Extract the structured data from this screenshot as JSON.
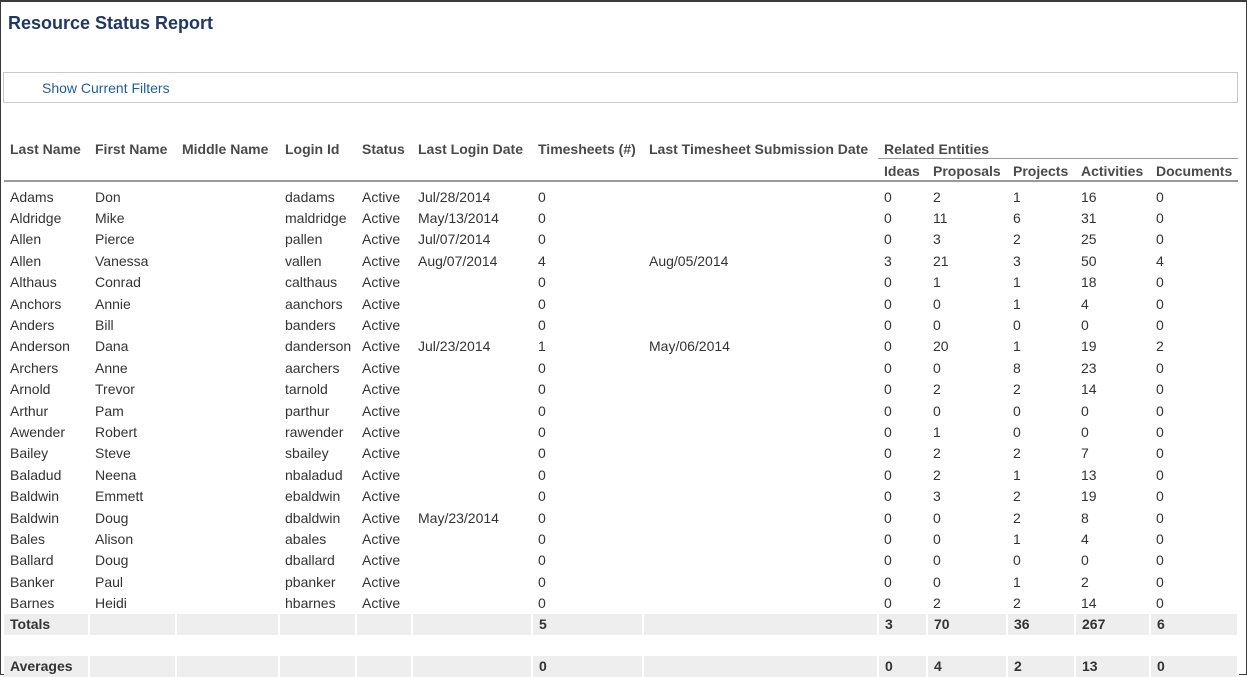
{
  "page": {
    "title": "Resource Status Report",
    "filters_link": "Show Current Filters"
  },
  "table": {
    "columns": {
      "last_name": "Last Name",
      "first_name": "First Name",
      "middle_name": "Middle Name",
      "login_id": "Login Id",
      "status": "Status",
      "last_login_date": "Last Login Date",
      "timesheets": "Timesheets (#)",
      "last_timesheet": "Last Timesheet Submission Date",
      "related_entities": "Related Entities",
      "ideas": "Ideas",
      "proposals": "Proposals",
      "projects": "Projects",
      "activities": "Activities",
      "documents": "Documents"
    },
    "rows": [
      [
        "Adams",
        "Don",
        "",
        "dadams",
        "Active",
        "Jul/28/2014",
        "0",
        "",
        "0",
        "2",
        "1",
        "16",
        "0"
      ],
      [
        "Aldridge",
        "Mike",
        "",
        "maldridge",
        "Active",
        "May/13/2014",
        "0",
        "",
        "0",
        "11",
        "6",
        "31",
        "0"
      ],
      [
        "Allen",
        "Pierce",
        "",
        "pallen",
        "Active",
        "Jul/07/2014",
        "0",
        "",
        "0",
        "3",
        "2",
        "25",
        "0"
      ],
      [
        "Allen",
        "Vanessa",
        "",
        "vallen",
        "Active",
        "Aug/07/2014",
        "4",
        "Aug/05/2014",
        "3",
        "21",
        "3",
        "50",
        "4"
      ],
      [
        "Althaus",
        "Conrad",
        "",
        "calthaus",
        "Active",
        "",
        "0",
        "",
        "0",
        "1",
        "1",
        "18",
        "0"
      ],
      [
        "Anchors",
        "Annie",
        "",
        "aanchors",
        "Active",
        "",
        "0",
        "",
        "0",
        "0",
        "1",
        "4",
        "0"
      ],
      [
        "Anders",
        "Bill",
        "",
        "banders",
        "Active",
        "",
        "0",
        "",
        "0",
        "0",
        "0",
        "0",
        "0"
      ],
      [
        "Anderson",
        "Dana",
        "",
        "danderson",
        "Active",
        "Jul/23/2014",
        "1",
        "May/06/2014",
        "0",
        "20",
        "1",
        "19",
        "2"
      ],
      [
        "Archers",
        "Anne",
        "",
        "aarchers",
        "Active",
        "",
        "0",
        "",
        "0",
        "0",
        "8",
        "23",
        "0"
      ],
      [
        "Arnold",
        "Trevor",
        "",
        "tarnold",
        "Active",
        "",
        "0",
        "",
        "0",
        "2",
        "2",
        "14",
        "0"
      ],
      [
        "Arthur",
        "Pam",
        "",
        "parthur",
        "Active",
        "",
        "0",
        "",
        "0",
        "0",
        "0",
        "0",
        "0"
      ],
      [
        "Awender",
        "Robert",
        "",
        "rawender",
        "Active",
        "",
        "0",
        "",
        "0",
        "1",
        "0",
        "0",
        "0"
      ],
      [
        "Bailey",
        "Steve",
        "",
        "sbailey",
        "Active",
        "",
        "0",
        "",
        "0",
        "2",
        "2",
        "7",
        "0"
      ],
      [
        "Baladud",
        "Neena",
        "",
        "nbaladud",
        "Active",
        "",
        "0",
        "",
        "0",
        "2",
        "1",
        "13",
        "0"
      ],
      [
        "Baldwin",
        "Emmett",
        "",
        "ebaldwin",
        "Active",
        "",
        "0",
        "",
        "0",
        "3",
        "2",
        "19",
        "0"
      ],
      [
        "Baldwin",
        "Doug",
        "",
        "dbaldwin",
        "Active",
        "May/23/2014",
        "0",
        "",
        "0",
        "0",
        "2",
        "8",
        "0"
      ],
      [
        "Bales",
        "Alison",
        "",
        "abales",
        "Active",
        "",
        "0",
        "",
        "0",
        "0",
        "1",
        "4",
        "0"
      ],
      [
        "Ballard",
        "Doug",
        "",
        "dballard",
        "Active",
        "",
        "0",
        "",
        "0",
        "0",
        "0",
        "0",
        "0"
      ],
      [
        "Banker",
        "Paul",
        "",
        "pbanker",
        "Active",
        "",
        "0",
        "",
        "0",
        "0",
        "1",
        "2",
        "0"
      ],
      [
        "Barnes",
        "Heidi",
        "",
        "hbarnes",
        "Active",
        "",
        "0",
        "",
        "0",
        "2",
        "2",
        "14",
        "0"
      ]
    ],
    "totals": {
      "label": "Totals",
      "timesheets": "5",
      "ideas": "3",
      "proposals": "70",
      "projects": "36",
      "activities": "267",
      "documents": "6"
    },
    "averages": {
      "label": "Averages",
      "timesheets": "0",
      "ideas": "0",
      "proposals": "4",
      "projects": "2",
      "activities": "13",
      "documents": "0"
    }
  }
}
